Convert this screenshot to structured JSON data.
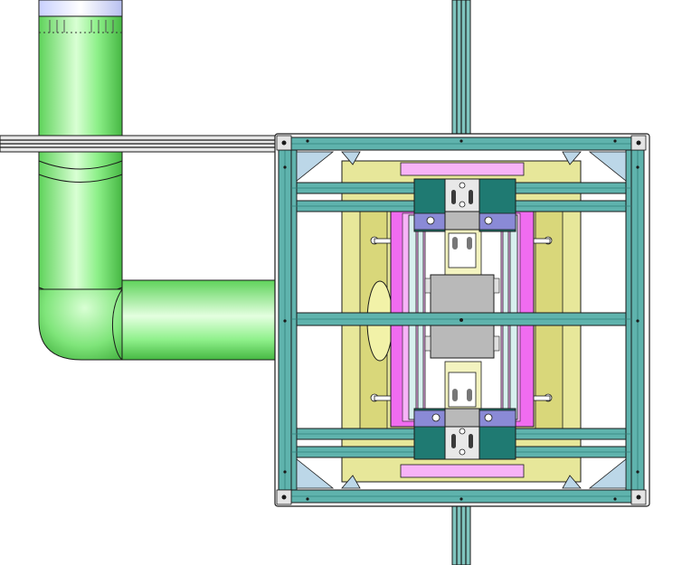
{
  "view": {
    "kind": "cad-drawing",
    "label": "",
    "background": "#ffffff"
  },
  "colors": {
    "pipe_green": "#8ef08a",
    "pipe_green_light": "#d9ffd4",
    "pipe_green_dark": "#4fc64c",
    "profile_teal": "#5fb3ad",
    "profile_teal_dark": "#2f7f7a",
    "plate_yellow": "#e7e79a",
    "plate_yellow_dark": "#c9c65a",
    "magenta": "#f06cf0",
    "magenta_light": "#f7b3f7",
    "grey_block": "#b9b9b9",
    "dark_teal_block": "#1f7a72",
    "blue_bracket": "#8a8ad6",
    "rail_dark": "#2a2a2a",
    "outline": "#1a1a1a"
  },
  "components": [
    {
      "name": "vertical-pipe"
    },
    {
      "name": "pipe-elbow"
    },
    {
      "name": "horizontal-pipe"
    },
    {
      "name": "horizontal-rail"
    },
    {
      "name": "vertical-rail"
    },
    {
      "name": "outer-frame"
    },
    {
      "name": "yellow-base-plate"
    },
    {
      "name": "magenta-carriage"
    },
    {
      "name": "center-bearing-block"
    },
    {
      "name": "top-clamp-assembly"
    },
    {
      "name": "bottom-clamp-assembly"
    }
  ]
}
